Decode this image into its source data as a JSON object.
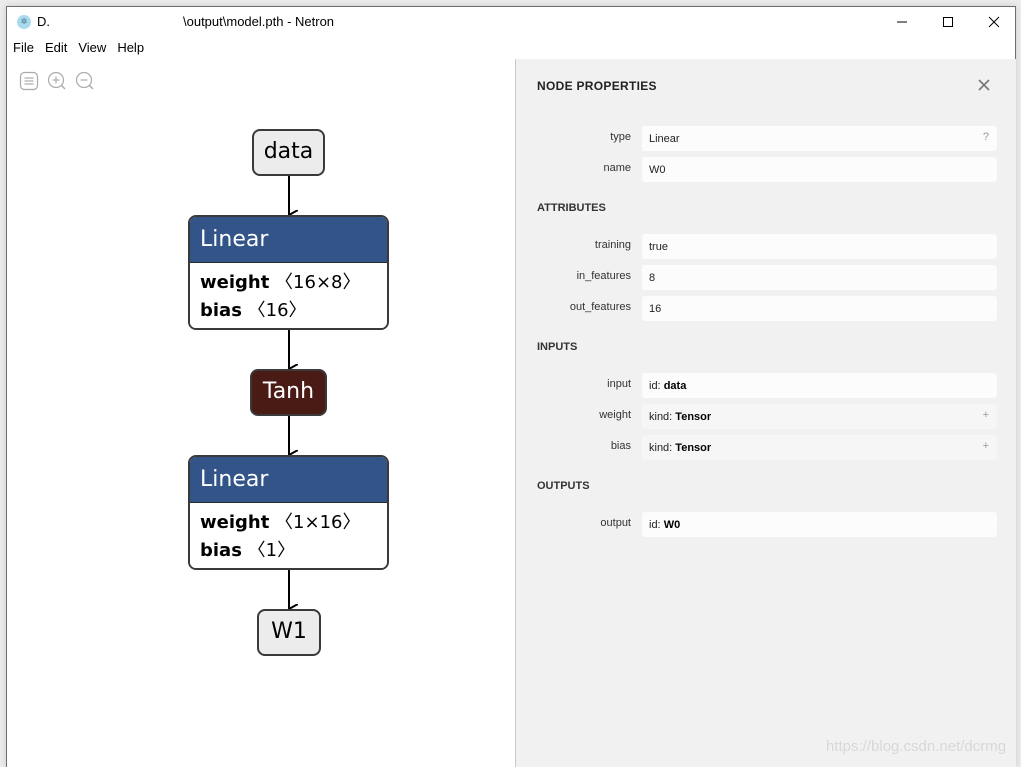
{
  "window": {
    "title_prefix": "D.",
    "title": "\\output\\model.pth - Netron",
    "app_icon": "netron-icon"
  },
  "menu": [
    "File",
    "Edit",
    "View",
    "Help"
  ],
  "toolbar": {
    "buttons": [
      "sidebar-toggle-icon",
      "zoom-in-icon",
      "zoom-out-icon"
    ]
  },
  "graph": {
    "nodes": [
      {
        "id": "data",
        "kind": "input",
        "label": "data"
      },
      {
        "id": "linear1",
        "kind": "layer",
        "label": "Linear",
        "attrs": [
          {
            "name": "weight",
            "shape": "〈16×8〉"
          },
          {
            "name": "bias",
            "shape": "〈16〉"
          }
        ]
      },
      {
        "id": "tanh",
        "kind": "activation",
        "label": "Tanh"
      },
      {
        "id": "linear2",
        "kind": "layer",
        "label": "Linear",
        "attrs": [
          {
            "name": "weight",
            "shape": "〈1×16〉"
          },
          {
            "name": "bias",
            "shape": "〈1〉"
          }
        ]
      },
      {
        "id": "w1",
        "kind": "output",
        "label": "W1"
      }
    ],
    "colors": {
      "layer_header": "#335488",
      "activation": "#4a1a14",
      "io": "#ececec"
    }
  },
  "sidebar": {
    "title": "NODE PROPERTIES",
    "properties": [
      {
        "label": "type",
        "value": "Linear",
        "expander": "?"
      },
      {
        "label": "name",
        "value": "W0"
      }
    ],
    "attributes_title": "ATTRIBUTES",
    "attributes": [
      {
        "label": "training",
        "value": "true"
      },
      {
        "label": "in_features",
        "value": "8"
      },
      {
        "label": "out_features",
        "value": "16"
      }
    ],
    "inputs_title": "INPUTS",
    "inputs": [
      {
        "label": "input",
        "prefix": "id: ",
        "value": "data"
      },
      {
        "label": "weight",
        "prefix": "kind: ",
        "value": "Tensor",
        "expander": "+"
      },
      {
        "label": "bias",
        "prefix": "kind: ",
        "value": "Tensor",
        "expander": "+"
      }
    ],
    "outputs_title": "OUTPUTS",
    "outputs": [
      {
        "label": "output",
        "prefix": "id: ",
        "value": "W0"
      }
    ]
  },
  "watermark": "https://blog.csdn.net/dcrmg"
}
